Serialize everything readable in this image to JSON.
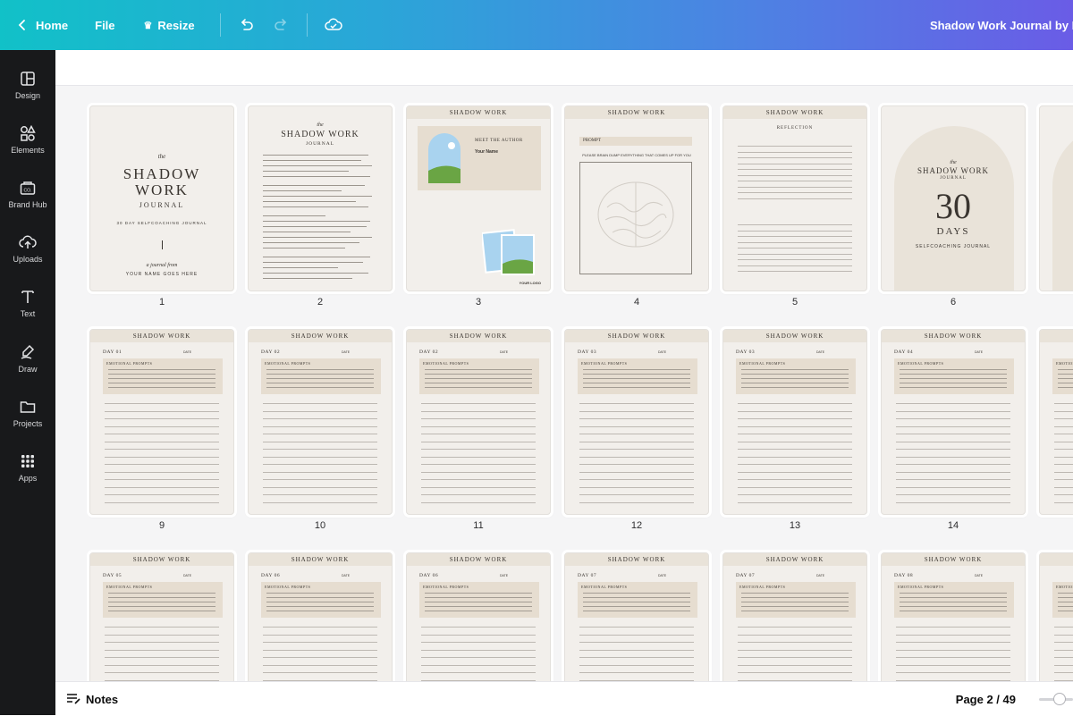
{
  "topbar": {
    "home_label": "Home",
    "file_label": "File",
    "resize_label": "Resize",
    "document_title": "Shadow Work Journal by H"
  },
  "sidebar": {
    "items": [
      {
        "label": "Design",
        "icon": "layout-icon"
      },
      {
        "label": "Elements",
        "icon": "shapes-icon"
      },
      {
        "label": "Brand Hub",
        "icon": "brand-hub-icon"
      },
      {
        "label": "Uploads",
        "icon": "cloud-upload-icon"
      },
      {
        "label": "Text",
        "icon": "text-icon"
      },
      {
        "label": "Draw",
        "icon": "draw-icon"
      },
      {
        "label": "Projects",
        "icon": "folder-icon"
      },
      {
        "label": "Apps",
        "icon": "apps-grid-icon"
      }
    ]
  },
  "journal": {
    "header": "SHADOW WORK",
    "cover_title_1": "SHADOW",
    "cover_title_2": "WORK",
    "cover_sub": "JOURNAL",
    "cover_line": "30 DAY SELFCOACHING JOURNAL",
    "cover_from": "a journal from",
    "cover_name": "YOUR NAME GOES HERE",
    "author_heading": "MEET THE AUTHOR",
    "your_name": "Your Name",
    "prompt_label": "PROMPT",
    "brain_dump": "PLEASE BRAIN DUMP EVERYTHING THAT COMES UP FOR YOU",
    "reflection": "REFLECTION",
    "days_number": "30",
    "days_word": "DAYS",
    "selfcoaching": "SELFCOACHING JOURNAL",
    "emotional_prompts": "EMOTIONAL PROMPTS",
    "date_label": "DATE",
    "logo_label": "YOUR LOGO",
    "day_labels": [
      "DAY 01",
      "DAY 02",
      "DAY 02",
      "DAY 03",
      "DAY 03",
      "DAY 04",
      "DAY 05",
      "DAY 06",
      "DAY 06",
      "DAY 07",
      "DAY 07",
      "DAY 08"
    ]
  },
  "page_numbers": {
    "row1": [
      "1",
      "2",
      "3",
      "4",
      "5",
      "6"
    ],
    "row2": [
      "9",
      "10",
      "11",
      "12",
      "13",
      "14"
    ]
  },
  "bottombar": {
    "notes_label": "Notes",
    "page_indicator": "Page 2 / 49",
    "zoom_level": 0.65
  },
  "colors": {
    "topbar_start": "#11c1c8",
    "topbar_end": "#6a5ce6",
    "sidebar_bg": "#18191b",
    "page_bg": "#f2efeb",
    "accent_band": "#e9e3d9"
  }
}
